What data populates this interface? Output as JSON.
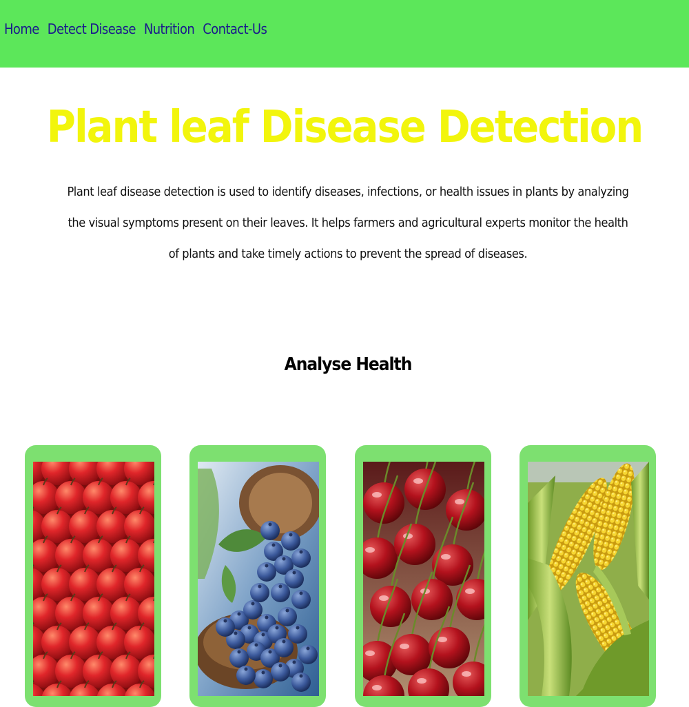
{
  "nav": {
    "items": [
      {
        "label": "Home"
      },
      {
        "label": "Detect Disease"
      },
      {
        "label": "Nutrition"
      },
      {
        "label": "Contact-Us"
      }
    ]
  },
  "hero": {
    "title": "Plant leaf Disease Detection",
    "description": "Plant leaf disease detection is used to identify diseases, infections, or health issues in plants by analyzing the visual symptoms present on their leaves. It helps farmers and agricultural experts monitor the health of plants and take timely actions to prevent the spread of diseases."
  },
  "analyse": {
    "title": "Analyse Health",
    "cards": [
      {
        "image": "apples-image"
      },
      {
        "image": "blueberries-image"
      },
      {
        "image": "cherries-image"
      },
      {
        "image": "corn-image"
      }
    ]
  },
  "colors": {
    "navbar": "#5ce75a",
    "nav_link": "#1a1a8c",
    "title": "#f2f50c",
    "card_frame": "#7de070"
  }
}
